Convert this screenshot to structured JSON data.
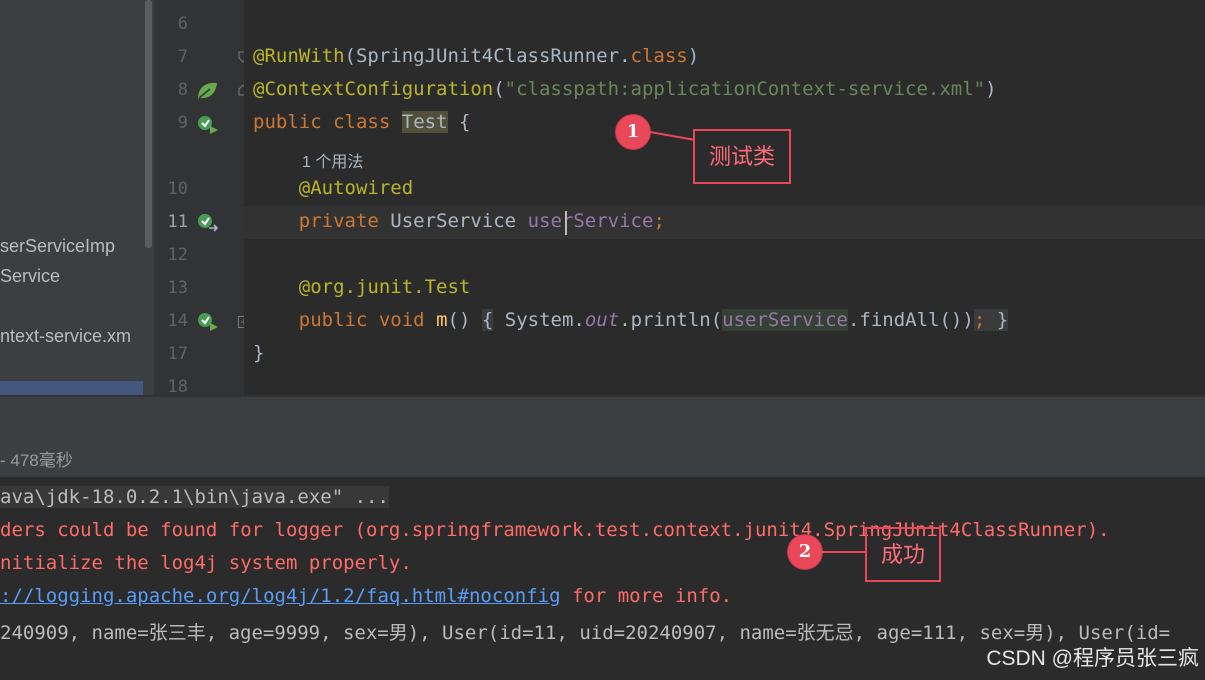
{
  "project_tree": {
    "items": [
      "serServiceImp",
      "Service",
      "ntext-service.xm"
    ]
  },
  "editor": {
    "line_numbers": [
      "6",
      "7",
      "8",
      "9",
      "10",
      "11",
      "12",
      "13",
      "14",
      "17",
      "18"
    ],
    "current_line": "11",
    "code": {
      "l7_annotation": "@RunWith",
      "l7_paren_open": "(",
      "l7_runner": "SpringJUnit4ClassRunner.",
      "l7_class_kw": "class",
      "l7_paren_close": ")",
      "l8_annotation": "@ContextConfiguration",
      "l8_paren_open": "(",
      "l8_string": "\"classpath:applicationContext-service.xml\"",
      "l8_paren_close": ")",
      "l9_public": "public",
      "l9_class": "class",
      "l9_name": "Test",
      "l9_brace": "{",
      "usage_hint": "1 个用法",
      "l10_annotation": "@Autowired",
      "l11_private": "private",
      "l11_type": "UserService",
      "l11_field": "userService",
      "l11_semi": ";",
      "l13_annotation_prefix": "@org.junit.",
      "l13_annotation_name": "Test",
      "l14_public": "public",
      "l14_void": "void",
      "l14_method": "m",
      "l14_parens": "()",
      "l14_open": "{",
      "l14_system": "System.",
      "l14_out": "out",
      "l14_println": ".println(",
      "l14_field": "userService",
      "l14_find": ".findAll())",
      "l14_semi": ";",
      "l14_close": "}",
      "l17_brace": "}"
    }
  },
  "run_panel": {
    "elapsed": "- 478毫秒",
    "console_lines": {
      "cmd": "ava\\jdk-18.0.2.1\\bin\\java.exe\" ...",
      "warn1": "ders could be found for logger (org.springframework.test.context.junit4.SpringJUnit4ClassRunner).",
      "warn2": "nitialize the log4j system properly.",
      "warn3_link": "://logging.apache.org/log4j/1.2/faq.html#noconfig",
      "warn3_tail": " for more info.",
      "output": "240909, name=张三丰, age=9999, sex=男), User(id=11, uid=20240907, name=张无忌, age=111, sex=男), User(id="
    }
  },
  "annotations": [
    {
      "number": "1",
      "label": "测试类"
    },
    {
      "number": "2",
      "label": "成功"
    }
  ],
  "watermark": "CSDN @程序员张三疯",
  "colors": {
    "keyword": "#cc7832",
    "annotation": "#bbb529",
    "string": "#6a8759",
    "field": "#9876aa",
    "method": "#ffc66d",
    "error_text": "#ff6b68",
    "link": "#589df6",
    "callout": "#e8485a"
  }
}
